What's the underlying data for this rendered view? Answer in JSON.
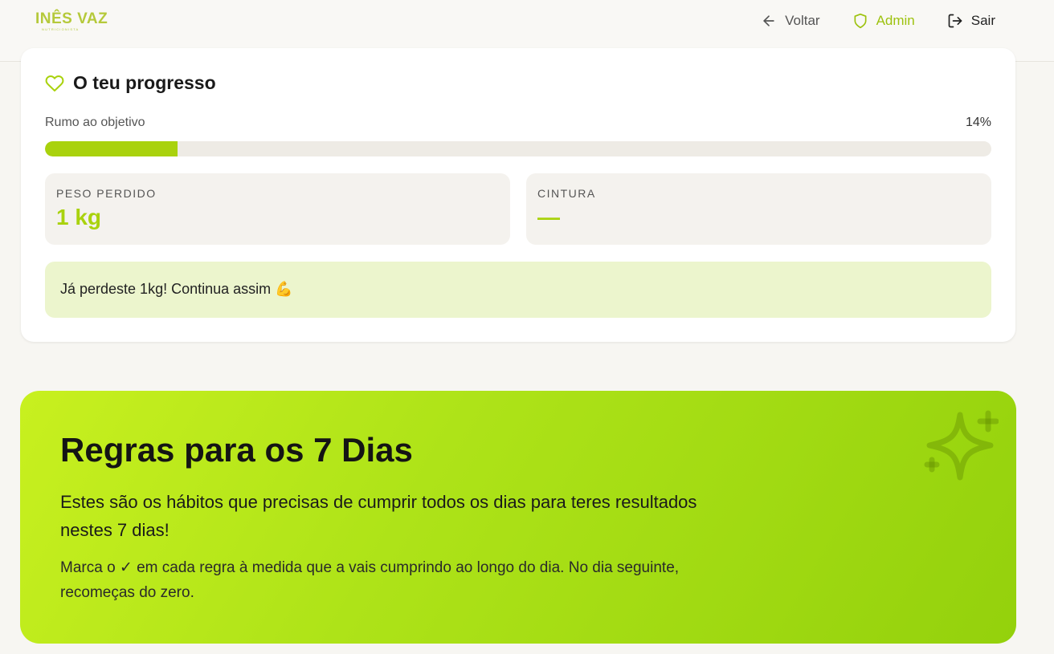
{
  "header": {
    "logo_name": "INÊS VAZ",
    "logo_sub": "NUTRICIONISTA",
    "nav": {
      "back_label": "Voltar",
      "admin_label": "Admin",
      "exit_label": "Sair"
    }
  },
  "progress": {
    "title": "O teu progresso",
    "goal_label": "Rumo ao objetivo",
    "percent_text": "14%",
    "percent_value": 0.14,
    "stats": [
      {
        "label": "PESO PERDIDO",
        "value": "1 kg"
      },
      {
        "label": "CINTURA",
        "value": "—"
      }
    ],
    "message": "Já perdeste 1kg! Continua assim 💪"
  },
  "banner": {
    "title": "Regras para os 7 Dias",
    "subtitle": "Estes são os hábitos que precisas de cumprir todos os dias para teres resultados nestes 7 dias!",
    "note": "Marca o ✓ em cada regra à medida que a vais cumprindo ao longo do dia. No dia seguinte, recomeças do zero."
  },
  "colors": {
    "accent": "#a9d20d",
    "track": "#eeebe5",
    "message_bg": "#ecf5cd",
    "banner_start": "#c8f01f",
    "banner_end": "#94d10c"
  }
}
